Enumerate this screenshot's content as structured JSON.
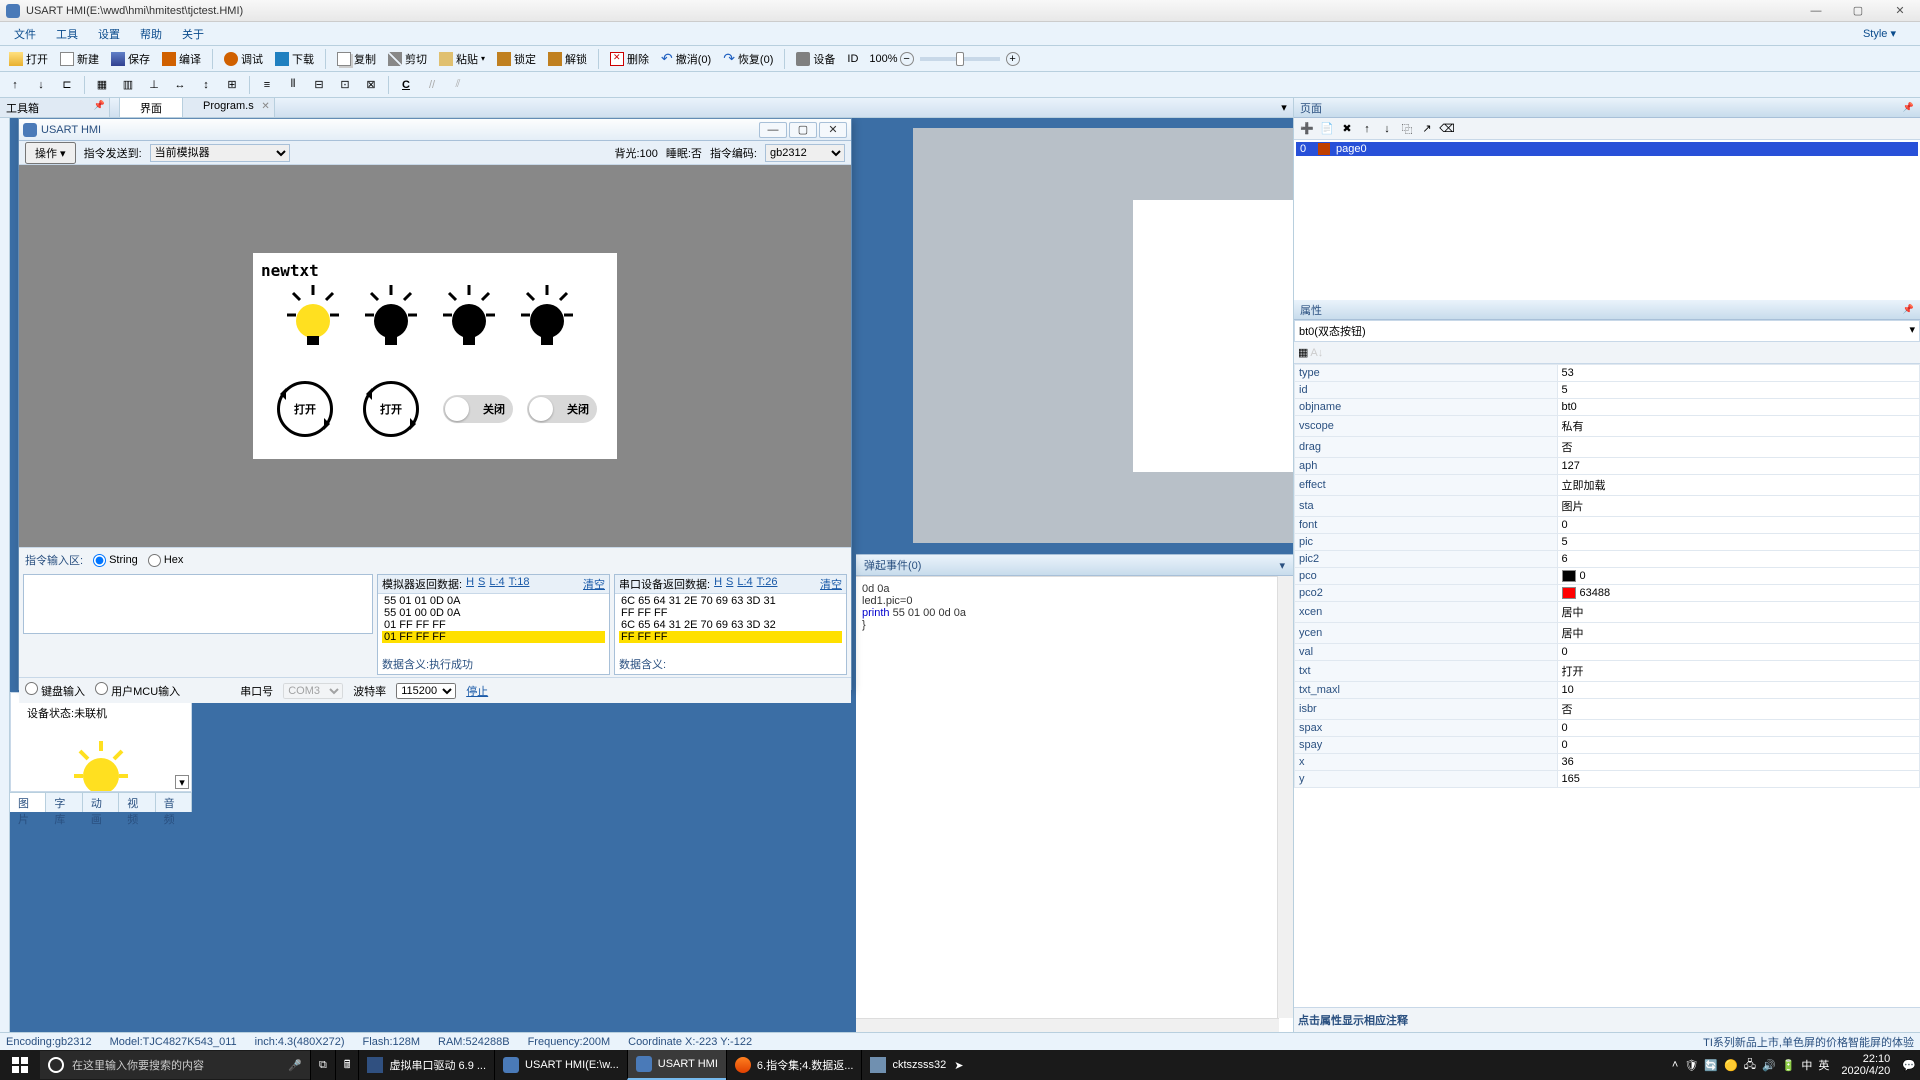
{
  "app": {
    "title": "USART HMI(E:\\wwd\\hmi\\hmitest\\tjctest.HMI)"
  },
  "menubar": [
    "文件",
    "工具",
    "设置",
    "帮助",
    "关于"
  ],
  "menubar_style": "Style ▾",
  "toolbar1": {
    "open": "打开",
    "new": "新建",
    "save": "保存",
    "compile": "编译",
    "debug": "调试",
    "download": "下载",
    "copy": "复制",
    "cut": "剪切",
    "paste": "粘贴",
    "lock": "锁定",
    "unlock": "解锁",
    "delete": "删除",
    "undo": "撤消(0)",
    "redo": "恢复(0)",
    "device": "设备",
    "id": "ID",
    "zoom": "100%"
  },
  "toolbox_tab": "工具箱",
  "tabs": [
    {
      "label": "界面",
      "active": true
    },
    {
      "label": "Program.s",
      "active": false
    }
  ],
  "page_design": {
    "newtxt": "newtxt",
    "btn_open1": "打开",
    "btn_open2": "打开",
    "btn_close1": "关闭",
    "btn_close2": "关闭",
    "side_close": "关闭"
  },
  "sim": {
    "title": "USART HMI",
    "op_btn": "操作",
    "send_to_lbl": "指令发送到:",
    "send_to": "当前模拟器",
    "bg_lbl": "背光:100",
    "sleep_lbl": "睡眠:否",
    "enc_lbl": "指令编码:",
    "encoding": "gb2312",
    "input_lbl": "指令输入区:",
    "r_string": "String",
    "r_hex": "Hex",
    "left_h": "模拟器返回数据:",
    "right_h": "串口设备返回数据:",
    "h_H": "H",
    "h_S": "S",
    "h_L_left": "L:4",
    "h_T_left": "T:18",
    "h_L_right": "L:4",
    "h_T_right": "T:26",
    "clear": "清空",
    "left_lines": [
      "55 01 01 0D 0A",
      "55 01 00 0D 0A",
      "01 FF FF FF",
      "01 FF FF FF"
    ],
    "right_lines": [
      "6C 65 64 31 2E 70 69 63 3D 31",
      "FF FF FF",
      "6C 65 64 31 2E 70 69 63 3D 32",
      "FF FF FF"
    ],
    "meaning_l_lbl": "数据含义:",
    "meaning_l": "执行成功",
    "meaning_r_lbl": "数据含义:",
    "kb_input": "键盘输入",
    "mcu_input": "用户MCU输入",
    "port_lbl": "串口号",
    "port": "COM3",
    "baud_lbl": "波特率",
    "baud": "115200",
    "stop_btn": "停止",
    "status_lbl": "设备状态:",
    "status": "未联机"
  },
  "event_tab": "弹起事件(0)",
  "event_code_lines": [
    "0d 0a",
    "led1.pic=0",
    "printh 55 01 00 0d 0a",
    "}"
  ],
  "bottom_tabs": [
    "图片",
    "字库",
    "动画",
    "视频",
    "音频"
  ],
  "right": {
    "page_title": "页面",
    "page_row_idx": "0",
    "page_row_name": "page0",
    "props_title": "属性",
    "props_obj": "bt0(双态按钮)",
    "props": [
      [
        "type",
        "53"
      ],
      [
        "id",
        "5"
      ],
      [
        "objname",
        "bt0"
      ],
      [
        "vscope",
        "私有"
      ],
      [
        "drag",
        "否"
      ],
      [
        "aph",
        "127"
      ],
      [
        "effect",
        "立即加载"
      ],
      [
        "sta",
        "图片"
      ],
      [
        "font",
        "0"
      ],
      [
        "pic",
        "5"
      ],
      [
        "pic2",
        "6"
      ],
      [
        "pco",
        "0"
      ],
      [
        "pco2",
        "63488"
      ],
      [
        "xcen",
        "居中"
      ],
      [
        "ycen",
        "居中"
      ],
      [
        "val",
        "0"
      ],
      [
        "txt",
        "打开"
      ],
      [
        "txt_maxl",
        "10"
      ],
      [
        "isbr",
        "否"
      ],
      [
        "spax",
        "0"
      ],
      [
        "spay",
        "0"
      ],
      [
        "x",
        "36"
      ],
      [
        "y",
        "165"
      ]
    ],
    "props_hint": "点击属性显示相应注释"
  },
  "statusbar": {
    "encoding": "Encoding:gb2312",
    "model": "Model:TJC4827K543_011",
    "inch": "inch:4.3(480X272)",
    "flash": "Flash:128M",
    "ram": "RAM:524288B",
    "freq": "Frequency:200M",
    "coord": "Coordinate X:-223   Y:-122",
    "promo": "TI系列新品上市,单色屏的价格智能屏的体验"
  },
  "taskbar": {
    "search_placeholder": "在这里输入你要搜索的内容",
    "apps": [
      "虚拟串口驱动 6.9 ...",
      "USART HMI(E:\\w...",
      "USART HMI",
      "6.指令集;4.数据返...",
      "cktszsss32"
    ],
    "time": "22:10",
    "date": "2020/4/20"
  }
}
